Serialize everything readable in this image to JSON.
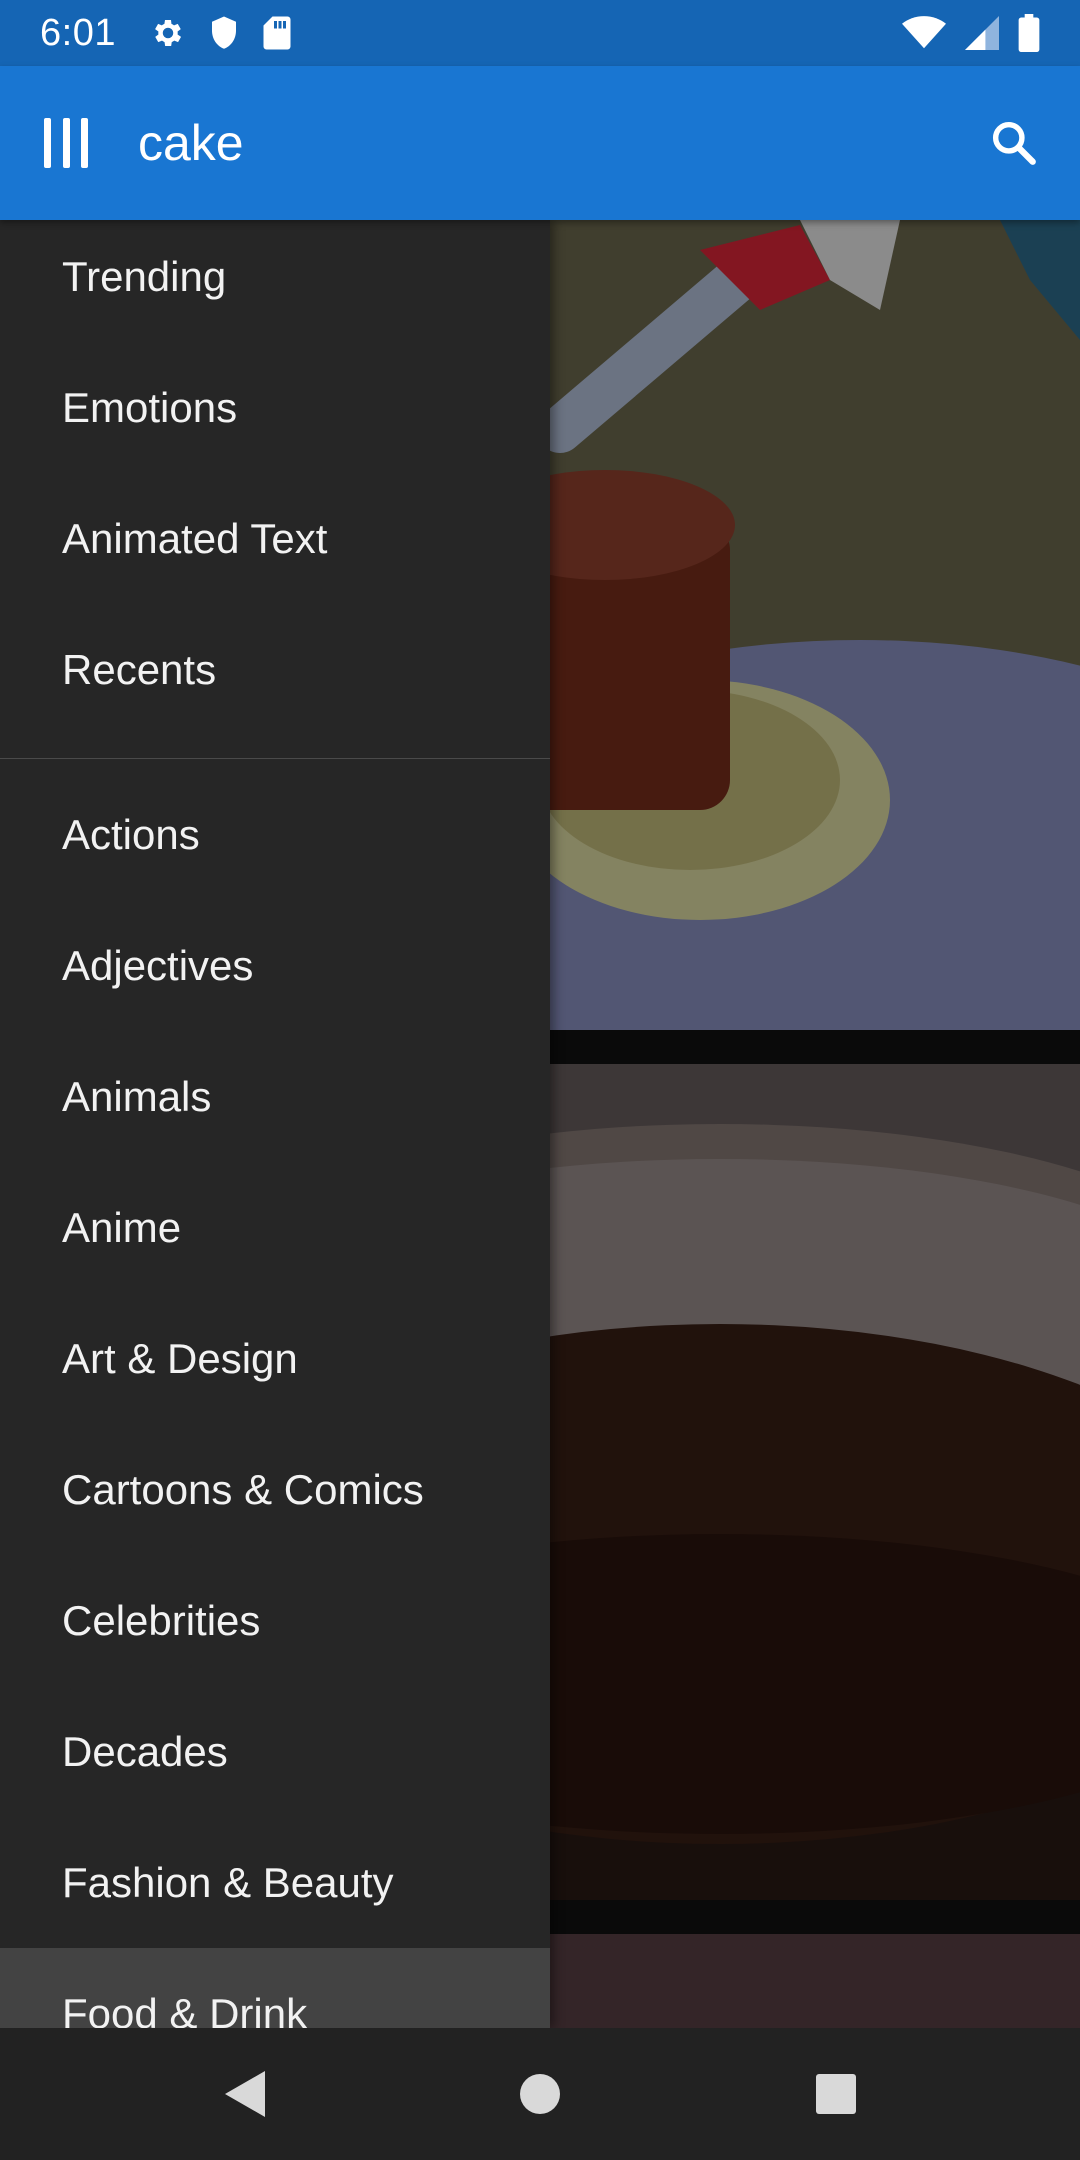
{
  "status_bar": {
    "time": "6:01",
    "left_icons": [
      "gear-icon",
      "shield-icon",
      "sd-card-icon"
    ],
    "right_icons": [
      "wifi-icon",
      "cell-signal-icon",
      "battery-icon"
    ]
  },
  "app_bar": {
    "menu_icon": "menu-icon",
    "search_query": "cake",
    "search_icon": "search-icon",
    "color": "#1976d2"
  },
  "drawer": {
    "primary_items": [
      {
        "label": "Trending"
      },
      {
        "label": "Emotions"
      },
      {
        "label": "Animated Text"
      },
      {
        "label": "Recents"
      }
    ],
    "category_items": [
      {
        "label": "Actions"
      },
      {
        "label": "Adjectives"
      },
      {
        "label": "Animals"
      },
      {
        "label": "Anime"
      },
      {
        "label": "Art & Design"
      },
      {
        "label": "Cartoons & Comics"
      },
      {
        "label": "Celebrities"
      },
      {
        "label": "Decades"
      },
      {
        "label": "Fashion & Beauty"
      },
      {
        "label": "Food & Drink"
      }
    ],
    "selected": "Food & Drink"
  },
  "nav_bar": {
    "back_icon": "back-triangle-icon",
    "home_icon": "home-circle-icon",
    "recents_icon": "recents-square-icon"
  }
}
